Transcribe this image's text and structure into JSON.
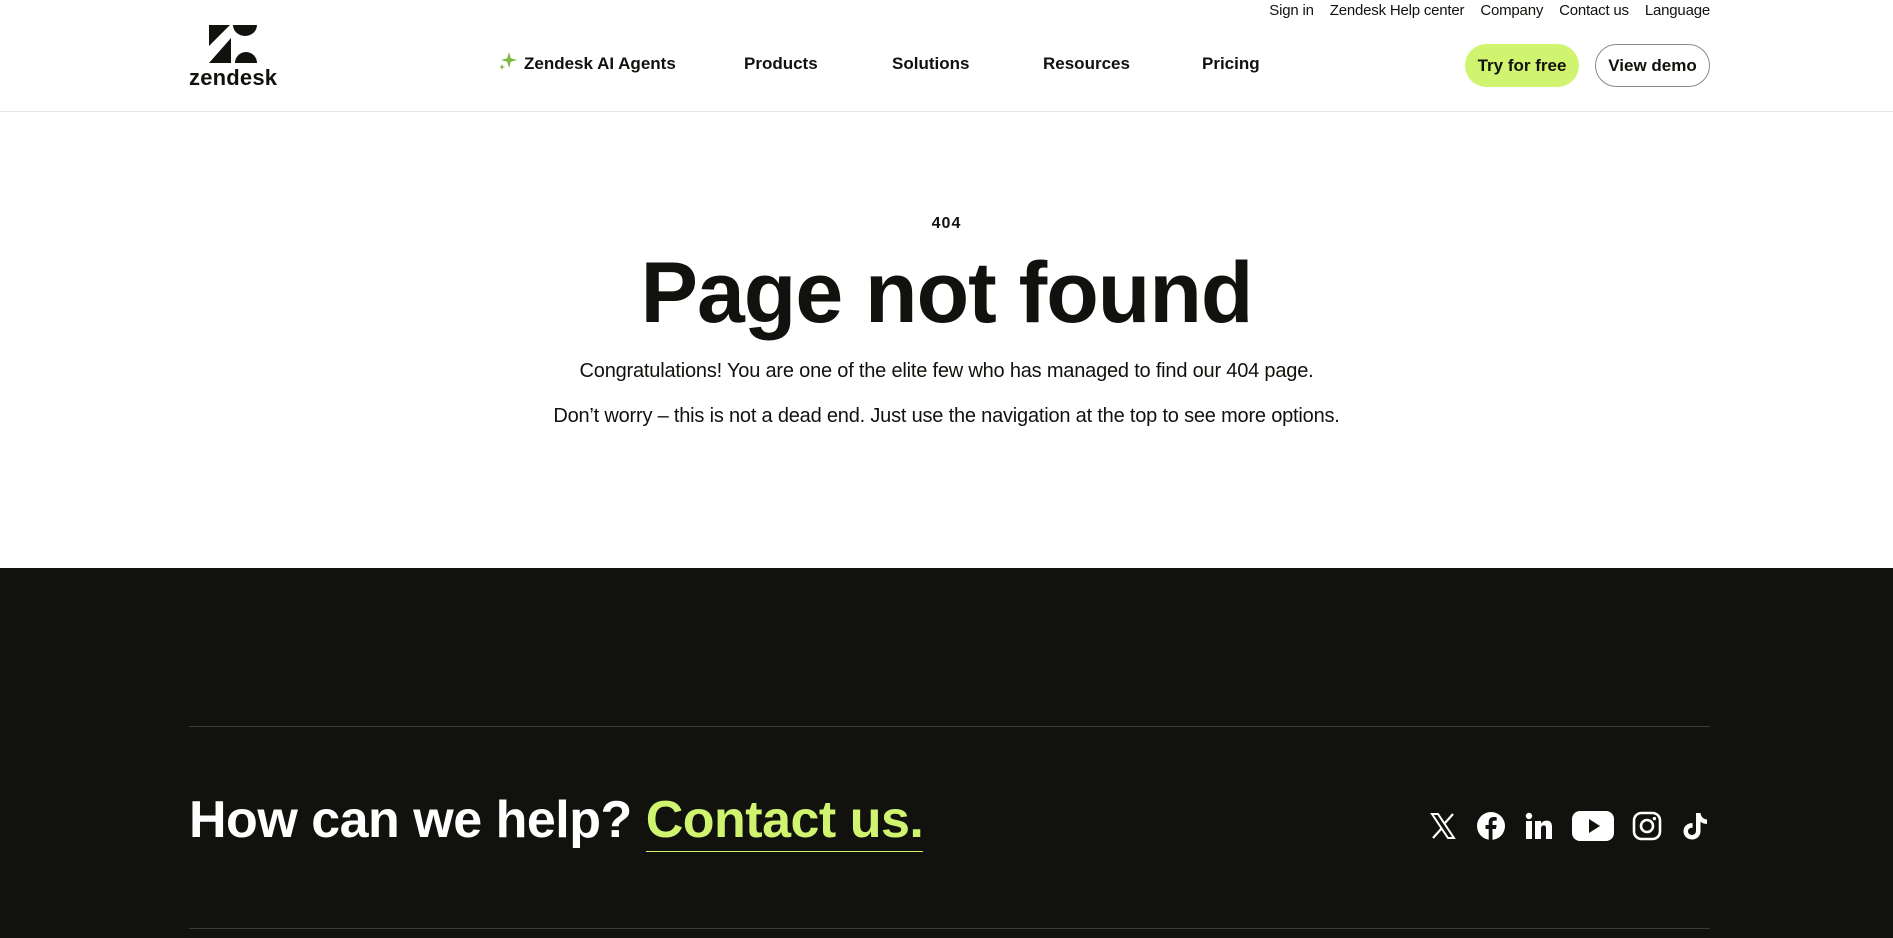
{
  "header": {
    "utility_links": [
      "Sign in",
      "Zendesk Help center",
      "Company",
      "Contact us",
      "Language"
    ],
    "logo_text": "zendesk",
    "nav": {
      "ai_agents": "Zendesk AI Agents",
      "products": "Products",
      "solutions": "Solutions",
      "resources": "Resources",
      "pricing": "Pricing"
    },
    "try_free": "Try for free",
    "view_demo": "View demo"
  },
  "main": {
    "code": "404",
    "title": "Page not found",
    "message1": "Congratulations! You are one of the elite few who has managed to find our 404 page.",
    "message2": "Don’t worry – this is not a dead end. Just use the navigation at the top to see more options."
  },
  "footer": {
    "help_text": "How can we help?",
    "contact_link": "Contact us.",
    "social_icons": [
      "x-icon",
      "facebook-icon",
      "linkedin-icon",
      "youtube-icon",
      "instagram-icon",
      "tiktok-icon"
    ]
  },
  "colors": {
    "accent": "#d1f470",
    "dark": "#11110d",
    "spark": "#7dbb3f"
  }
}
